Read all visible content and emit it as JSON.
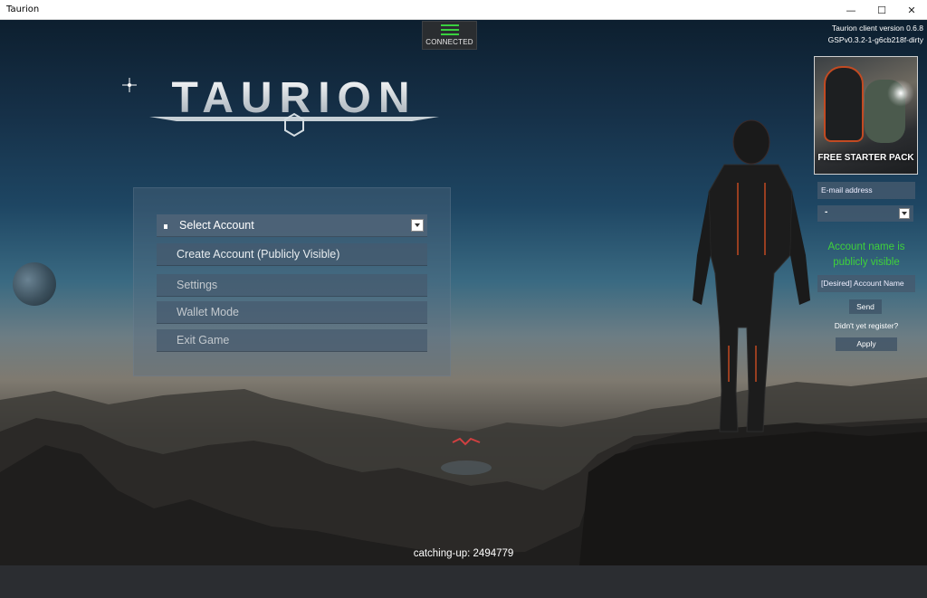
{
  "window": {
    "title": "Taurion",
    "minimize": "—",
    "maximize": "☐",
    "close": "✕"
  },
  "status": {
    "label": "CONNECTED",
    "color": "#39d13f"
  },
  "logo": {
    "text": "TAURION"
  },
  "version": {
    "client": "Taurion client version 0.6.8",
    "gsp": "GSPv0.3.2-1-g6cb218f-dirty"
  },
  "menu": {
    "select_account": "Select Account",
    "items": [
      {
        "label": "Create Account (Publicly Visible)"
      },
      {
        "label": "Settings"
      },
      {
        "label": "Wallet Mode"
      },
      {
        "label": "Exit Game"
      }
    ]
  },
  "promo": {
    "label": "FREE STARTER PACK"
  },
  "register": {
    "email_placeholder": "E-mail address",
    "account_select_value": "-",
    "public_note": "Account name is publicly visible",
    "desired_placeholder": "[Desired] Account Name",
    "send": "Send",
    "not_registered": "Didn't yet register?",
    "apply": "Apply"
  },
  "footer": {
    "catching_up": "catching-up: 2494779"
  },
  "icons": {
    "connection": "connection-bars-icon",
    "dropdown": "chevron-down-icon"
  }
}
